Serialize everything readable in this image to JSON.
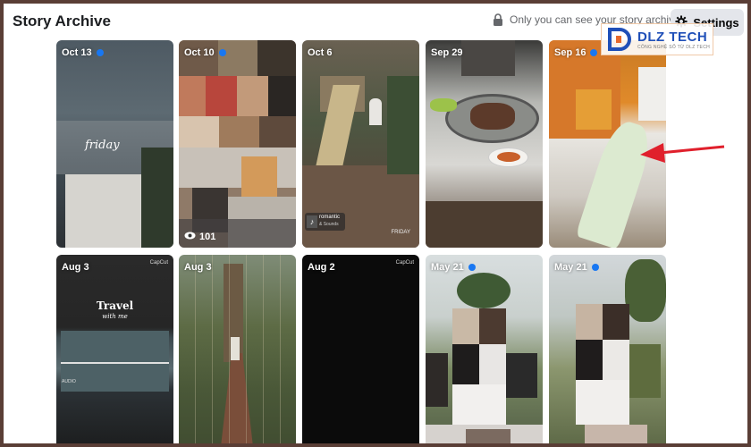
{
  "page": {
    "title": "Story Archive",
    "privacy_text": "Only you can see your story archive",
    "settings_label": "Settings"
  },
  "watermark": {
    "name": "DLZ TECH",
    "subtitle": "CÔNG NGHỆ SỐ TỪ DLZ TECH"
  },
  "stories": [
    {
      "date": "Oct 13",
      "unread_dot": true
    },
    {
      "date": "Oct 10",
      "unread_dot": true,
      "views": "101"
    },
    {
      "date": "Oct 6",
      "unread_dot": false,
      "music_title": "romantic",
      "music_sub": "& Sounds",
      "tag": "FRIDAY"
    },
    {
      "date": "Sep 29",
      "unread_dot": false
    },
    {
      "date": "Sep 16",
      "unread_dot": true
    },
    {
      "date": "Aug 3",
      "unread_dot": false,
      "capcut": "CapCut",
      "overlay_title": "Travel",
      "overlay_sub": "with me",
      "audio": "AUDIO"
    },
    {
      "date": "Aug 3",
      "unread_dot": false
    },
    {
      "date": "Aug 2",
      "unread_dot": false,
      "capcut": "CapCut"
    },
    {
      "date": "May 21",
      "unread_dot": true
    },
    {
      "date": "May 21",
      "unread_dot": true
    }
  ],
  "overlay_script": "friday",
  "colors": {
    "accent_dot": "#1877f2",
    "arrow": "#e0202c",
    "settings_bg": "#e4e6eb"
  },
  "icons": [
    "lock-icon",
    "gear-icon",
    "eye-icon",
    "music-icon",
    "red-arrow-annotation"
  ]
}
